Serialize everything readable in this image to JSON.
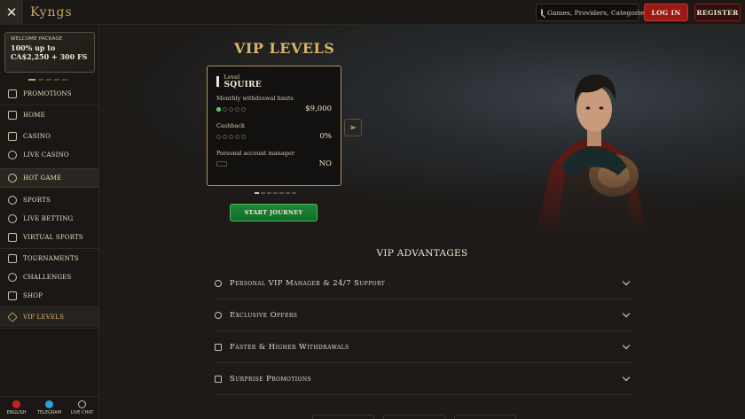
{
  "topbar": {
    "logo": "Kyngs",
    "search_placeholder": "Games, Providers, Categories",
    "login_label": "LOG IN",
    "register_label": "REGISTER",
    "icons": [
      "close-icon",
      "search-icon"
    ]
  },
  "sidebar": {
    "promo": {
      "heading": "WELCOME PACKAGE",
      "offer_line1": "100% up to",
      "offer_line2": "CA$2,250 + 300 FS"
    },
    "items": [
      {
        "label": "PROMOTIONS",
        "icon": "gift-icon"
      },
      {
        "label": "HOME",
        "icon": "home-icon"
      },
      {
        "label": "CASINO",
        "icon": "casino-icon"
      },
      {
        "label": "LIVE CASINO",
        "icon": "live-casino-icon"
      },
      {
        "label": "HOT GAME",
        "icon": "fire-icon"
      },
      {
        "label": "SPORTS",
        "icon": "sports-icon"
      },
      {
        "label": "LIVE BETTING",
        "icon": "live-betting-icon"
      },
      {
        "label": "VIRTUAL SPORTS",
        "icon": "virtual-sports-icon"
      },
      {
        "label": "TOURNAMENTS",
        "icon": "trophy-icon"
      },
      {
        "label": "CHALLENGES",
        "icon": "challenges-icon"
      },
      {
        "label": "SHOP",
        "icon": "shop-icon"
      },
      {
        "label": "VIP LEVELS",
        "icon": "diamond-icon"
      }
    ],
    "footer": [
      {
        "label": "ENGLISH",
        "icon": "flag-icon",
        "color": "#c8221c"
      },
      {
        "label": "TELEGRAM",
        "icon": "telegram-icon",
        "color": "#2aa1da"
      },
      {
        "label": "LIVE CHAT",
        "icon": "chat-icon",
        "color": "#cfc3ad"
      }
    ]
  },
  "main": {
    "vip_title": "VIP LEVELS",
    "card": {
      "level_label": "Level",
      "level_name": "SQUIRE",
      "withdrawal_label": "Monthly withdrawal limits",
      "withdrawal_value": "$9,000",
      "withdrawal_pips_filled": 1,
      "cashback_label": "Cashback",
      "cashback_value": "0%",
      "cashback_pips_filled": 0,
      "manager_label": "Personal account manager",
      "manager_value": "NO"
    },
    "next_icon": "chevron-right-icon",
    "start_label": "START JOURNEY",
    "advantages_title": "VIP ADVANTAGES",
    "advantages": [
      {
        "label": "Personal VIP Manager & 24/7 Support",
        "icon": "support-icon"
      },
      {
        "label": "Exclusive Offers",
        "icon": "user-icon"
      },
      {
        "label": "Faster & Higher Withdrawals",
        "icon": "withdraw-icon"
      },
      {
        "label": "Surprise Promotions",
        "icon": "present-icon"
      }
    ]
  },
  "colors": {
    "accent_gold": "#d9b46a",
    "login_red": "#9a1a16",
    "start_green": "#1f8a3a"
  }
}
